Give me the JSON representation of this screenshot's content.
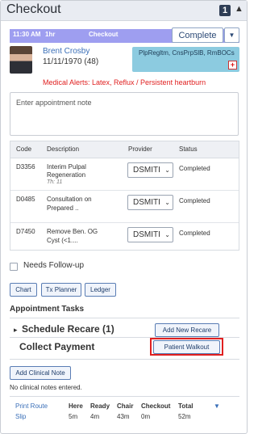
{
  "header": {
    "title": "Checkout",
    "count": "1"
  },
  "appointment": {
    "time": "11:30 AM",
    "duration": "1hr",
    "status": "Checkout",
    "complete_label": "Complete"
  },
  "patient": {
    "name": "Brent Crosby",
    "dob": "11/11/1970",
    "age": "(48)",
    "alerts_summary": "PlpRegltm, CnsPrpSlB, RmBOCs",
    "medical_alerts": "Medical Alerts: Latex, Reflux / Persistent heartburn"
  },
  "note": {
    "placeholder": "Enter appointment note"
  },
  "procedures": {
    "headers": [
      "Code",
      "Description",
      "Provider",
      "Status"
    ],
    "rows": [
      {
        "code": "D3356",
        "desc1": "Interim Pulpal",
        "desc2": "Regeneration",
        "tooth": "Th:  11",
        "provider": "DSMITI",
        "status": "Completed"
      },
      {
        "code": "D0485",
        "desc1": "Consultation on",
        "desc2": "Prepared ..",
        "tooth": "",
        "provider": "DSMITI",
        "status": "Completed"
      },
      {
        "code": "D7450",
        "desc1": "Remove Ben. OG",
        "desc2": "Cyst (<1....",
        "tooth": "",
        "provider": "DSMITI",
        "status": "Completed"
      }
    ]
  },
  "followup_label": "Needs Follow-up",
  "buttons": {
    "chart": "Chart",
    "tx_planner": "Tx Planner",
    "ledger": "Ledger"
  },
  "tasks": {
    "title": "Appointment Tasks",
    "schedule_recare": "Schedule Recare (1)",
    "add_recare": "Add New Recare",
    "collect_payment": "Collect Payment",
    "patient_walkout": "Patient Walkout"
  },
  "clinical": {
    "add_label": "Add Clinical Note",
    "none_text": "No clinical notes entered."
  },
  "footer": {
    "print_route_1": "Print Route",
    "print_route_2": "Slip",
    "stats": [
      {
        "label": "Here",
        "value": "5m"
      },
      {
        "label": "Ready",
        "value": "4m"
      },
      {
        "label": "Chair",
        "value": "43m"
      },
      {
        "label": "Checkout",
        "value": "0m"
      },
      {
        "label": "Total",
        "value": "52m"
      }
    ]
  },
  "colors": {
    "accent": "#3a6fb8",
    "appt_bar": "#9e9ef0",
    "alert_red": "#e02020",
    "alert_box": "#8ccbe0"
  }
}
